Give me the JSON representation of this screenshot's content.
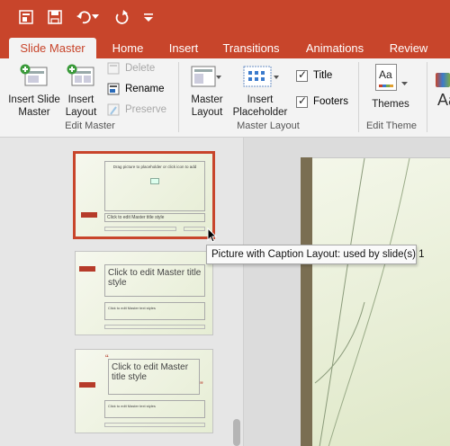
{
  "qat": {
    "icons": [
      "slide-master-view-icon",
      "save-icon",
      "undo-icon",
      "redo-icon",
      "customize-qat-icon"
    ]
  },
  "tabs": [
    {
      "label": "Slide Master",
      "active": true
    },
    {
      "label": "Home",
      "active": false
    },
    {
      "label": "Insert",
      "active": false
    },
    {
      "label": "Transitions",
      "active": false
    },
    {
      "label": "Animations",
      "active": false
    },
    {
      "label": "Review",
      "active": false
    }
  ],
  "ribbon": {
    "edit_master": {
      "insert_slide_master": "Insert Slide\nMaster",
      "insert_slide_master_l1": "Insert Slide",
      "insert_slide_master_l2": "Master",
      "insert_layout_l1": "Insert",
      "insert_layout_l2": "Layout",
      "delete": "Delete",
      "rename": "Rename",
      "preserve": "Preserve",
      "group_label": "Edit Master"
    },
    "master_layout": {
      "master_layout_l1": "Master",
      "master_layout_l2": "Layout",
      "insert_placeholder_l1": "Insert",
      "insert_placeholder_l2": "Placeholder",
      "title_checkbox": "Title",
      "footers_checkbox": "Footers",
      "group_label": "Master Layout"
    },
    "edit_theme": {
      "themes": "Themes",
      "group_label": "Edit Theme",
      "theme_icon_text": "Aa",
      "fonts_icon_text": "Aa"
    }
  },
  "thumbnails": [
    {
      "title": "Drag picture to placeholder or click icon to add",
      "caption": "Click to edit Master title style",
      "selected": true
    },
    {
      "title": "Click to edit Master title style",
      "subtitle": "Click to edit Master text styles",
      "selected": false
    },
    {
      "title": "Click to edit Master title style",
      "subtitle": "Click to edit Master text styles",
      "selected": false
    }
  ],
  "tooltip": {
    "text": "Picture with Caption Layout: used by slide(s) 1"
  },
  "colors": {
    "accent": "#c8452b",
    "ribbon_bg": "#f3f3f3",
    "slide_bar": "#7a6e52"
  }
}
